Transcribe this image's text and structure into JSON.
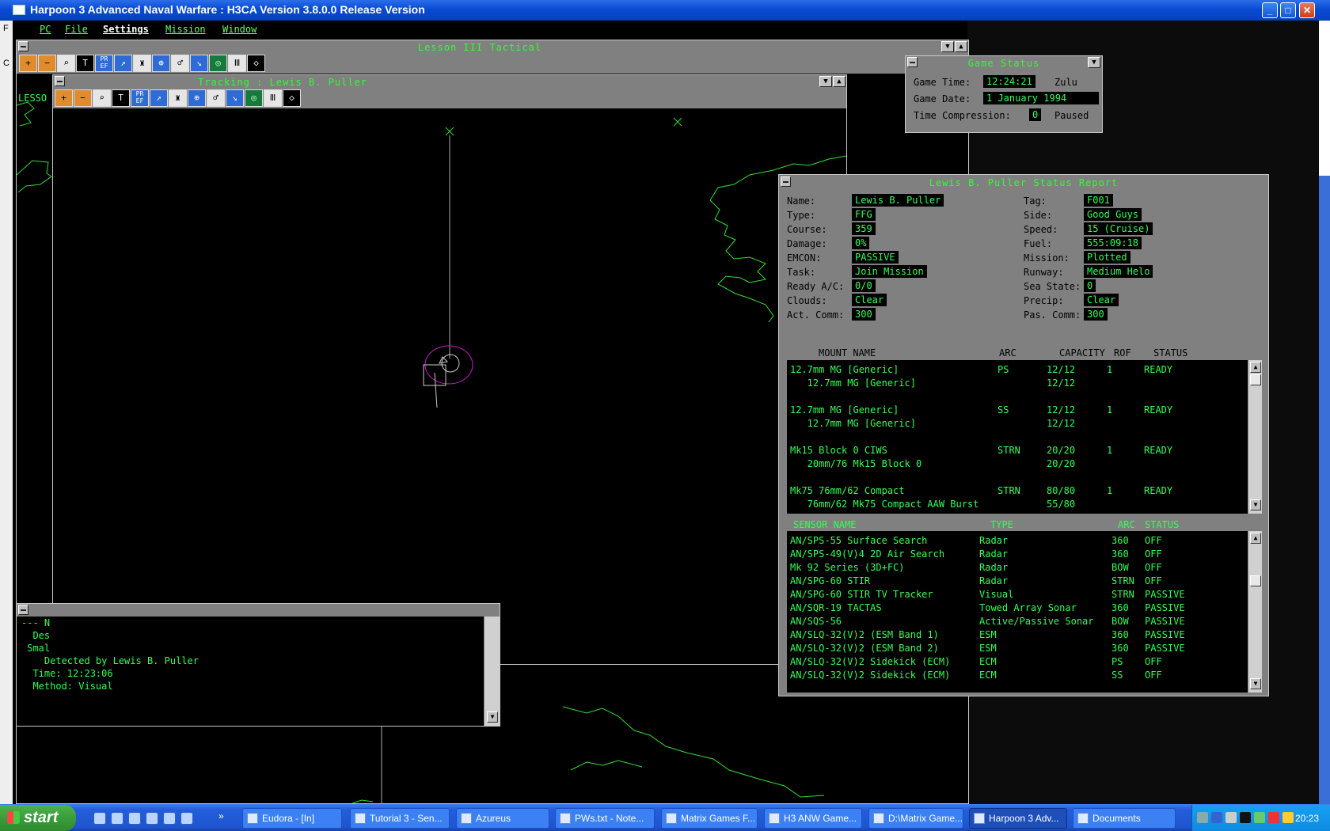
{
  "app": {
    "title": "Harpoon 3 Advanced Naval Warfare : H3CA Version 3.8.0.0 Release Version",
    "window_buttons": [
      "_",
      "□",
      "✕"
    ]
  },
  "menu": [
    "PC",
    "File",
    "Settings",
    "Mission",
    "Window"
  ],
  "desktop_left_labels": [
    "F",
    "C"
  ],
  "tactical_window": {
    "title": "Lesson III Tactical",
    "side_label": "LESSO",
    "tools": [
      "zoom-in",
      "zoom-out",
      "zoom-fit",
      "labels",
      "pref",
      "weapon",
      "unit",
      "compass",
      "radar",
      "sonar",
      "map",
      "scope",
      "levels",
      "flag"
    ]
  },
  "tracking_window": {
    "title": "Tracking : Lewis B. Puller",
    "tools": [
      "zoom-in",
      "zoom-out",
      "zoom-fit",
      "labels",
      "pref",
      "weapon",
      "unit",
      "compass",
      "radar",
      "sonar",
      "map",
      "scope",
      "levels",
      "flag"
    ]
  },
  "game_status": {
    "title": "Game Status",
    "labels": {
      "time": "Game Time:",
      "date": "Game Date:",
      "compression": "Time Compression:"
    },
    "time": "12:24:21",
    "zone": "Zulu",
    "date": "1 January 1994",
    "compression": "0",
    "state": "Paused"
  },
  "message_window": {
    "lines": [
      "--- N",
      "  Des",
      " Smal",
      "    Detected by Lewis B. Puller",
      "  Time: 12:23:06",
      "  Method: Visual"
    ]
  },
  "status_report": {
    "title": "Lewis B. Puller Status Report",
    "left": [
      {
        "label": "Name:",
        "value": "Lewis B. Puller"
      },
      {
        "label": "Type:",
        "value": "FFG"
      },
      {
        "label": "Course:",
        "value": "359"
      },
      {
        "label": "Damage:",
        "value": "0%"
      },
      {
        "label": "EMCON:",
        "value": "PASSIVE"
      },
      {
        "label": "Task:",
        "value": "Join Mission"
      },
      {
        "label": "Ready A/C:",
        "value": "0/0"
      },
      {
        "label": "Clouds:",
        "value": "Clear"
      },
      {
        "label": "Act. Comm:",
        "value": "300"
      }
    ],
    "right": [
      {
        "label": "Tag:",
        "value": "F001"
      },
      {
        "label": "Side:",
        "value": "Good Guys"
      },
      {
        "label": "Speed:",
        "value": "15 (Cruise)"
      },
      {
        "label": "Fuel:",
        "value": "555:09:18"
      },
      {
        "label": "Mission:",
        "value": "Plotted"
      },
      {
        "label": "Runway:",
        "value": "Medium Helo"
      },
      {
        "label": "Sea State:",
        "value": "0"
      },
      {
        "label": "Precip:",
        "value": "Clear"
      },
      {
        "label": "Pas. Comm:",
        "value": "300"
      }
    ],
    "mount_headers": [
      "MOUNT NAME",
      "ARC",
      "CAPACITY",
      "ROF",
      "STATUS"
    ],
    "mounts": [
      {
        "name": "12.7mm MG [Generic]",
        "arc": "PS",
        "capacity": "12/12",
        "rof": "1",
        "status": "READY"
      },
      {
        "name": "   12.7mm MG [Generic]",
        "arc": "",
        "capacity": "12/12",
        "rof": "",
        "status": ""
      },
      {
        "name": "",
        "arc": "",
        "capacity": "",
        "rof": "",
        "status": ""
      },
      {
        "name": "12.7mm MG [Generic]",
        "arc": "SS",
        "capacity": "12/12",
        "rof": "1",
        "status": "READY"
      },
      {
        "name": "   12.7mm MG [Generic]",
        "arc": "",
        "capacity": "12/12",
        "rof": "",
        "status": ""
      },
      {
        "name": "",
        "arc": "",
        "capacity": "",
        "rof": "",
        "status": ""
      },
      {
        "name": "Mk15 Block 0 CIWS",
        "arc": "STRN",
        "capacity": "20/20",
        "rof": "1",
        "status": "READY"
      },
      {
        "name": "   20mm/76 Mk15 Block 0",
        "arc": "",
        "capacity": "20/20",
        "rof": "",
        "status": ""
      },
      {
        "name": "",
        "arc": "",
        "capacity": "",
        "rof": "",
        "status": ""
      },
      {
        "name": "Mk75 76mm/62 Compact",
        "arc": "STRN",
        "capacity": "80/80",
        "rof": "1",
        "status": "READY"
      },
      {
        "name": "   76mm/62 Mk75 Compact AAW Burst",
        "arc": "",
        "capacity": "55/80",
        "rof": "",
        "status": ""
      }
    ],
    "sensor_headers": [
      "SENSOR NAME",
      "TYPE",
      "ARC",
      "STATUS"
    ],
    "sensors": [
      {
        "name": "AN/SPS-55 Surface Search",
        "type": "Radar",
        "arc": "360",
        "status": "OFF"
      },
      {
        "name": "AN/SPS-49(V)4 2D Air Search",
        "type": "Radar",
        "arc": "360",
        "status": "OFF"
      },
      {
        "name": "Mk 92 Series (3D+FC)",
        "type": "Radar",
        "arc": "BOW",
        "status": "OFF"
      },
      {
        "name": "AN/SPG-60 STIR",
        "type": "Radar",
        "arc": "STRN",
        "status": "OFF"
      },
      {
        "name": "AN/SPG-60 STIR TV Tracker",
        "type": "Visual",
        "arc": "STRN",
        "status": "PASSIVE"
      },
      {
        "name": "AN/SQR-19 TACTAS",
        "type": "Towed Array Sonar",
        "arc": "360",
        "status": "PASSIVE"
      },
      {
        "name": "AN/SQS-56",
        "type": "Active/Passive Sonar",
        "arc": "BOW",
        "status": "PASSIVE"
      },
      {
        "name": "AN/SLQ-32(V)2 (ESM Band 1)",
        "type": "ESM",
        "arc": "360",
        "status": "PASSIVE"
      },
      {
        "name": "AN/SLQ-32(V)2 (ESM Band 2)",
        "type": "ESM",
        "arc": "360",
        "status": "PASSIVE"
      },
      {
        "name": "AN/SLQ-32(V)2 Sidekick (ECM)",
        "type": "ECM",
        "arc": "PS",
        "status": "OFF"
      },
      {
        "name": "AN/SLQ-32(V)2 Sidekick (ECM)",
        "type": "ECM",
        "arc": "SS",
        "status": "OFF"
      }
    ]
  },
  "taskbar": {
    "start": "start",
    "items": [
      {
        "label": "Eudora - [In]",
        "active": false
      },
      {
        "label": "Tutorial 3 - Sen...",
        "active": false
      },
      {
        "label": "Azureus",
        "active": false
      },
      {
        "label": "PWs.txt - Note...",
        "active": false
      },
      {
        "label": "Matrix Games F...",
        "active": false
      },
      {
        "label": "H3 ANW Game...",
        "active": false
      },
      {
        "label": "D:\\Matrix Game...",
        "active": false
      },
      {
        "label": "Harpoon 3 Adv...",
        "active": true
      },
      {
        "label": "Documents",
        "active": false
      }
    ],
    "clock": "20:23"
  },
  "colors": {
    "terminal_green": "#33ff55",
    "window_gray": "#808080",
    "coast_green": "#33dd33",
    "contact_magenta": "#c020c0"
  }
}
